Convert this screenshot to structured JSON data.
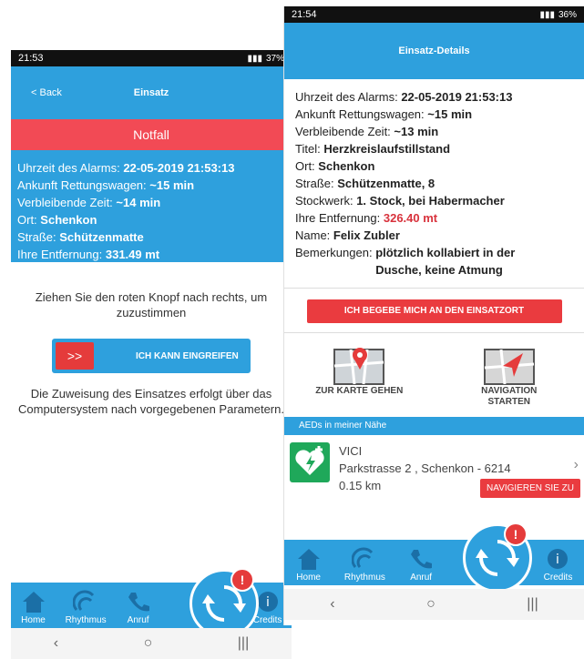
{
  "left": {
    "status": {
      "time": "21:53",
      "battery": "37%"
    },
    "header": {
      "back": "< Back",
      "title": "Einsatz"
    },
    "banner": "Notfall",
    "info": {
      "alarm_label": "Uhrzeit des Alarms:",
      "alarm_value": "22-05-2019 21:53:13",
      "ambulance_label": "Ankunft Rettungswagen:",
      "ambulance_value": "~15 min",
      "remaining_label": "Verbleibende Zeit:",
      "remaining_value": "~14 min",
      "place_label": "Ort:",
      "place_value": "Schenkon",
      "street_label": "Straße:",
      "street_value": "Schützenmatte",
      "distance_label": "Ihre Entfernung:",
      "distance_value": "331.49 mt"
    },
    "instruction": "Ziehen Sie den roten Knopf nach rechts, um zuzustimmen",
    "slider": {
      "knob": ">>",
      "label": "ICH KANN EINGREIFEN"
    },
    "assign_text": "Die Zuweisung des Einsatzes erfolgt über das Computersystem nach vorgegebenen Parametern.",
    "nav": {
      "home": "Home",
      "rhythm": "Rhythmus",
      "call": "Anruf",
      "credits": "Credits"
    },
    "alert": "!"
  },
  "right": {
    "status": {
      "time": "21:54",
      "battery": "36%"
    },
    "header": {
      "title": "Einsatz-Details"
    },
    "details": {
      "alarm_label": "Uhrzeit des Alarms:",
      "alarm_value": "22-05-2019 21:53:13",
      "ambulance_label": "Ankunft Rettungswagen:",
      "ambulance_value": "~15 min",
      "remaining_label": "Verbleibende Zeit:",
      "remaining_value": "~13 min",
      "title_label": "Titel:",
      "title_value": "Herzkreislaufstillstand",
      "place_label": "Ort:",
      "place_value": "Schenkon",
      "street_label": "Straße:",
      "street_value": "Schützenmatte, 8",
      "floor_label": "Stockwerk:",
      "floor_value": "1. Stock, bei Habermacher",
      "distance_label": "Ihre Entfernung:",
      "distance_value": "326.40 mt",
      "name_label": "Name:",
      "name_value": "Felix Zubler",
      "remarks_label": "Bemerkungen:",
      "remarks_value": "plötzlich kollabiert in der Dusche, keine Atmung"
    },
    "go_button": "ICH BEGEBE MICH AN DEN EINSATZORT",
    "map_button": "ZUR KARTE GEHEN",
    "navigation_button": "NAVIGATION STARTEN",
    "aed_header": "AEDs in meiner Nähe",
    "aed": {
      "name": "VICI",
      "address": "Parkstrasse 2 , Schenkon - 6214",
      "distance": "0.15 km",
      "navigate": "NAVIGIEREN SIE ZU"
    },
    "nav": {
      "home": "Home",
      "rhythm": "Rhythmus",
      "call": "Anruf",
      "credits": "Credits"
    },
    "alert": "!"
  }
}
